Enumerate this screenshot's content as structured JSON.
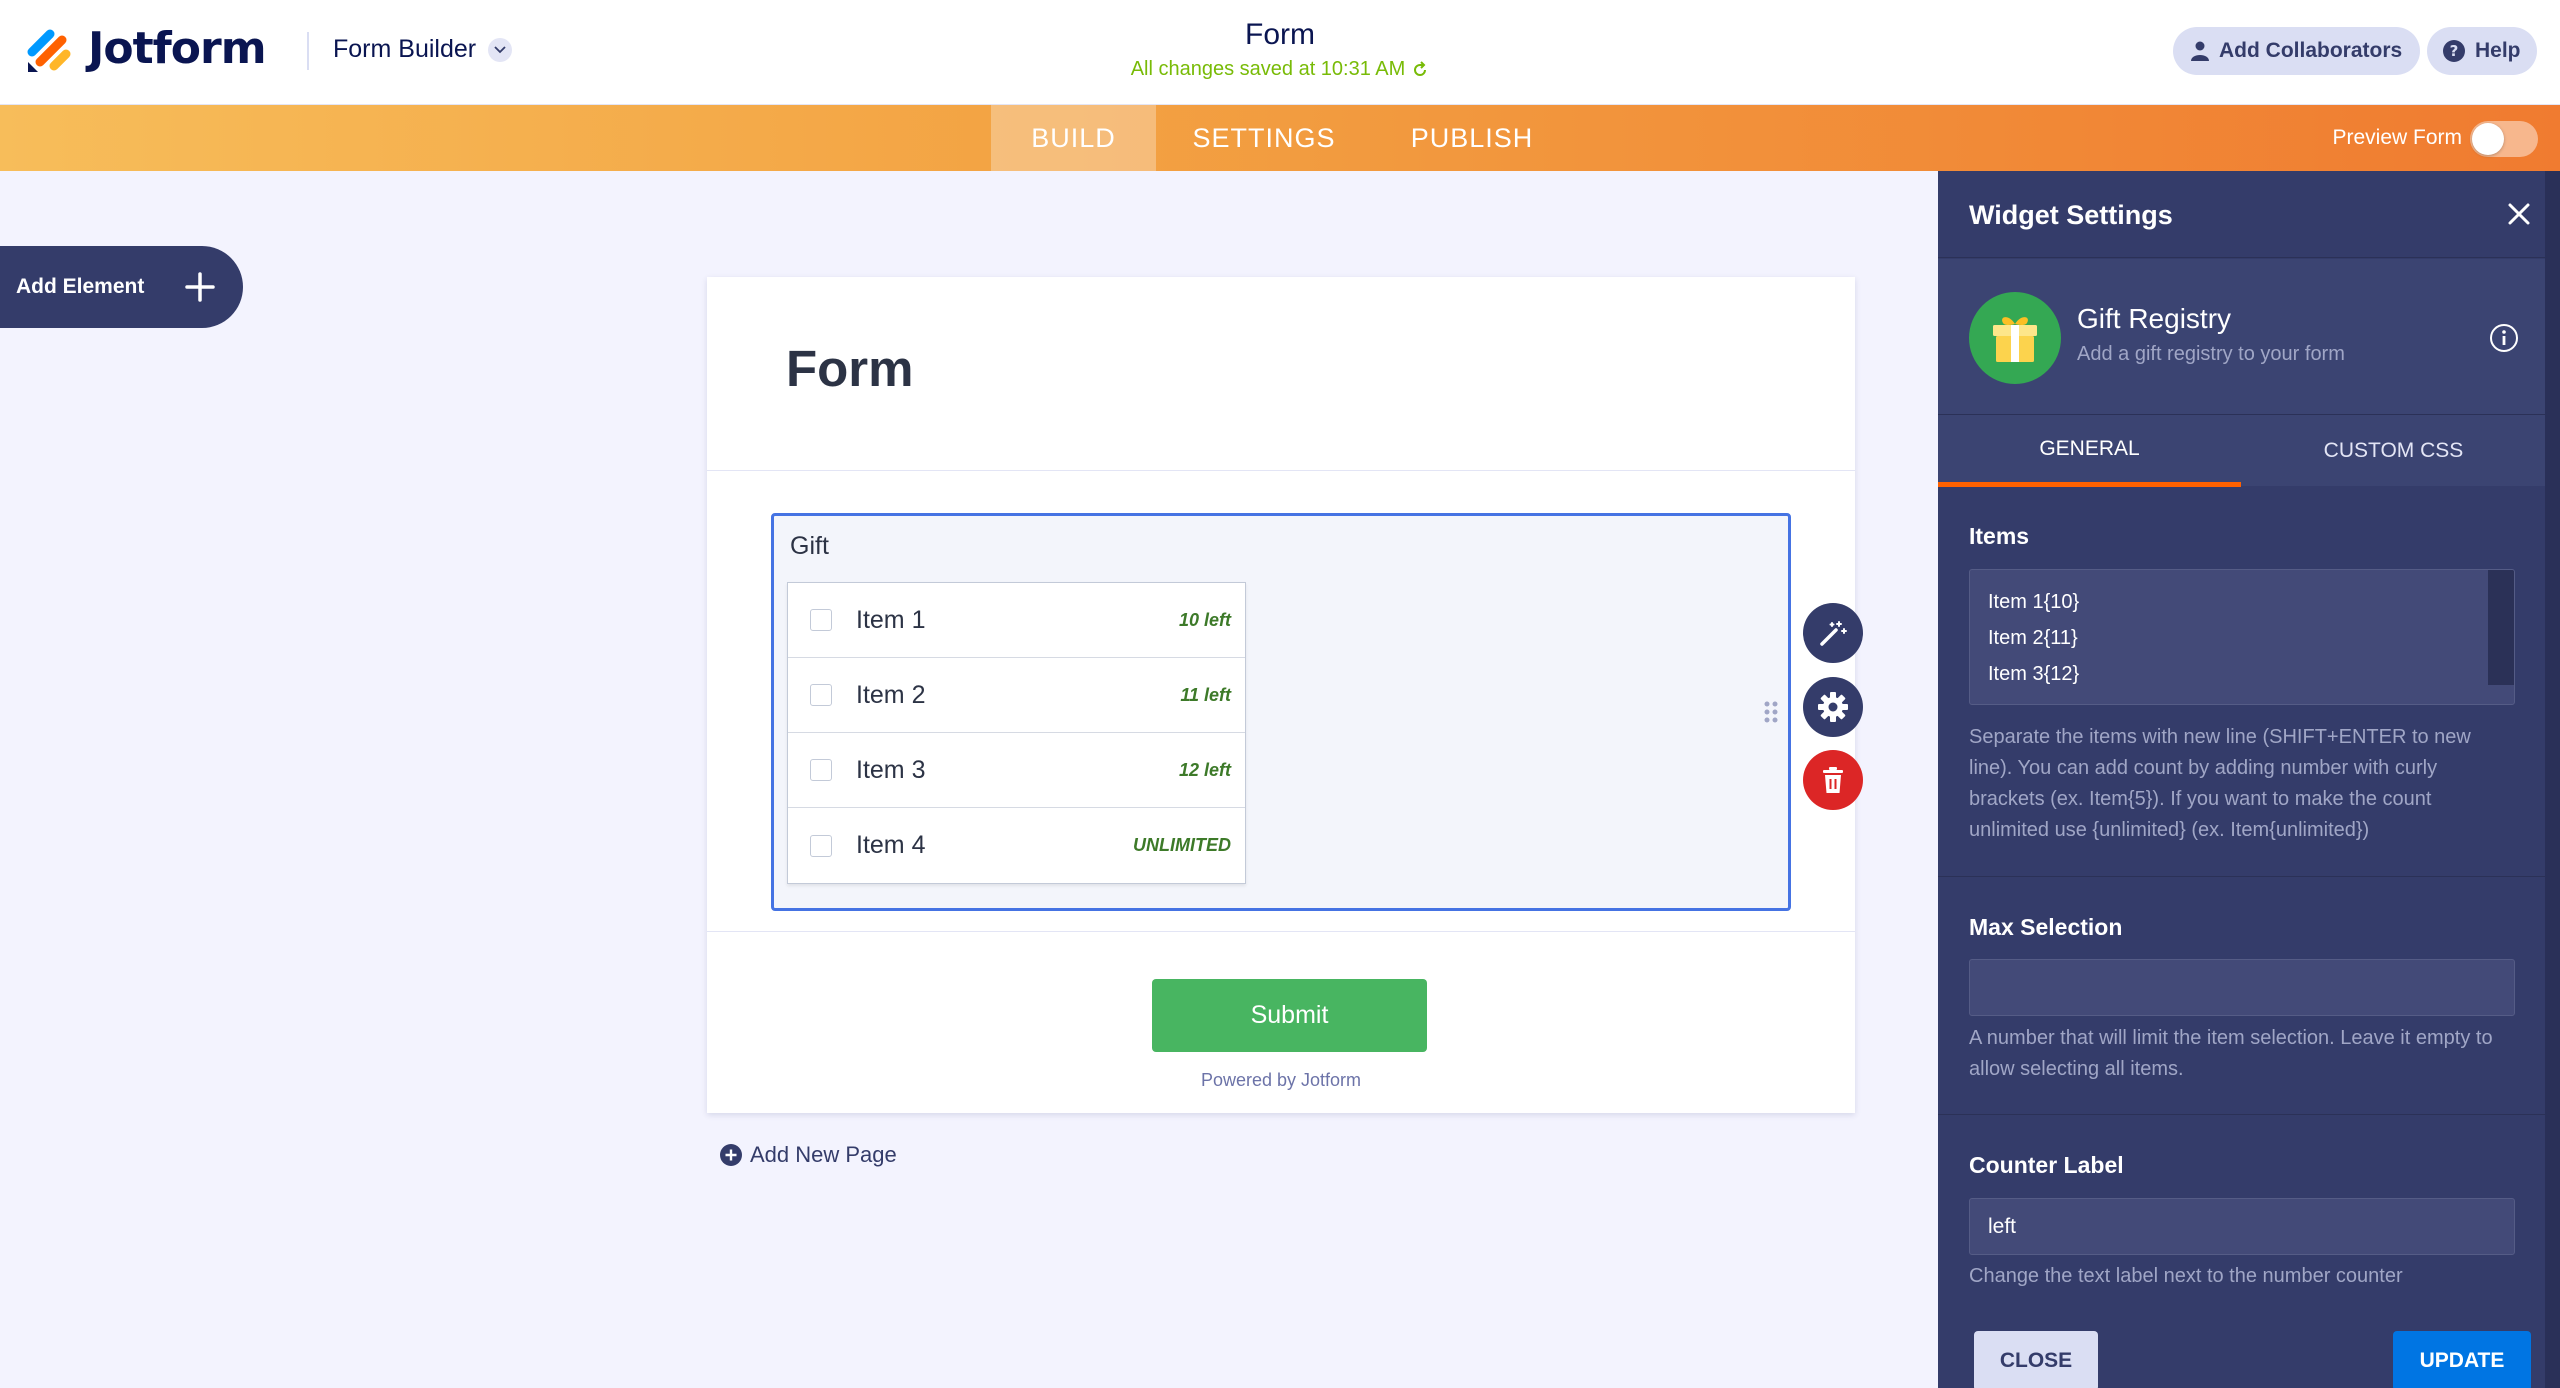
{
  "header": {
    "brand": "Jotform",
    "builder_label": "Form Builder",
    "form_title": "Form",
    "save_status": "All changes saved at 10:31 AM",
    "add_collaborators": "Add Collaborators",
    "help": "Help"
  },
  "nav": {
    "tabs": [
      "BUILD",
      "SETTINGS",
      "PUBLISH"
    ],
    "active_tab": "BUILD",
    "preview_label": "Preview Form",
    "preview_enabled": false
  },
  "left": {
    "add_element": "Add Element"
  },
  "form": {
    "title": "Form",
    "widget_label": "Gift",
    "items": [
      {
        "name": "Item 1",
        "count": "10 left"
      },
      {
        "name": "Item 2",
        "count": "11 left"
      },
      {
        "name": "Item 3",
        "count": "12 left"
      },
      {
        "name": "Item 4",
        "count": "UNLIMITED"
      }
    ],
    "submit": "Submit",
    "powered_by": "Powered by Jotform",
    "add_page": "Add New Page"
  },
  "panel": {
    "title": "Widget Settings",
    "widget_name": "Gift Registry",
    "widget_desc": "Add a gift registry to your form",
    "tabs": [
      "GENERAL",
      "CUSTOM CSS"
    ],
    "active_tab": "GENERAL",
    "items_label": "Items",
    "items_lines": [
      "Item 1{10}",
      "Item 2{11}",
      "Item 3{12}"
    ],
    "items_help": "Separate the items with new line (SHIFT+ENTER to new line). You can add count by adding number with curly brackets (ex. Item{5}). If you want to make the count unlimited use {unlimited} (ex. Item{unlimited})",
    "max_label": "Max Selection",
    "max_value": "",
    "max_help": "A number that will limit the item selection. Leave it empty to allow selecting all items.",
    "counter_label": "Counter Label",
    "counter_value": "left",
    "counter_help": "Change the text label next to the number counter",
    "close": "CLOSE",
    "update": "UPDATE"
  },
  "colors": {
    "accent_orange": "#ff6100",
    "panel_bg": "#343c6a",
    "submit_green": "#48b561",
    "selection_blue": "#4573e3",
    "update_blue": "#0075e3",
    "delete_red": "#dc2626"
  },
  "icons": [
    "jotform-logo-icon",
    "chevron-down-icon",
    "refresh-icon",
    "user-icon",
    "help-icon",
    "plus-icon",
    "wand-icon",
    "gear-icon",
    "trash-icon",
    "drag-handle-icon",
    "plus-circle-icon",
    "close-icon",
    "gift-icon",
    "info-icon"
  ]
}
